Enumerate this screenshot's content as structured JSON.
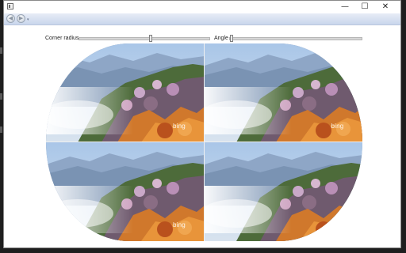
{
  "window": {
    "controls": {
      "minimize": "—",
      "maximize": "☐",
      "close": "✕"
    },
    "nav": {
      "back": "◀",
      "forward": "▶",
      "dropdown": "▾"
    }
  },
  "controls": {
    "corner_radius": {
      "label": "Corner radius",
      "value": 0.55
    },
    "angle": {
      "label": "Angle",
      "value": 0.0
    }
  },
  "image": {
    "tiles": 4,
    "watermark": "bing"
  }
}
